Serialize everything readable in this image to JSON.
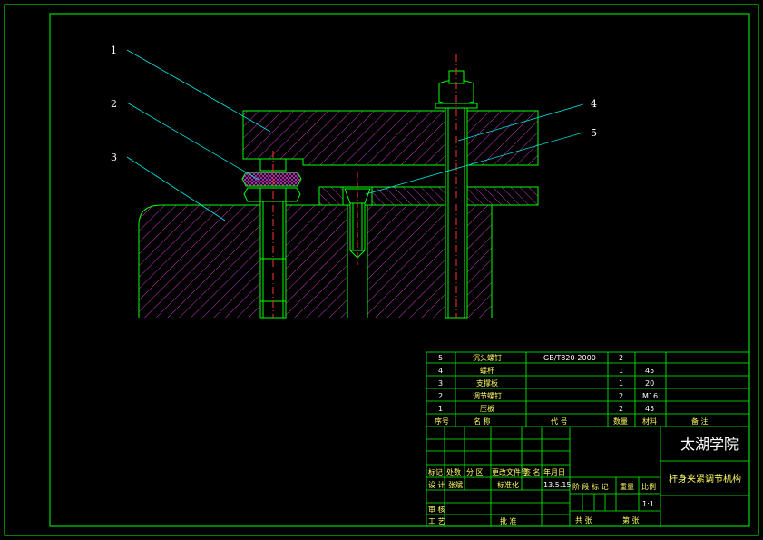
{
  "callouts": [
    "1",
    "2",
    "3",
    "4",
    "5"
  ],
  "parts": [
    {
      "no": "5",
      "name": "沉头螺钉",
      "code": "GB/T820-2000",
      "qty": "2",
      "material": "",
      "note": ""
    },
    {
      "no": "4",
      "name": "螺杆",
      "code": "",
      "qty": "1",
      "material": "45",
      "note": ""
    },
    {
      "no": "3",
      "name": "支撑板",
      "code": "",
      "qty": "1",
      "material": "20",
      "note": ""
    },
    {
      "no": "2",
      "name": "调节螺钉",
      "code": "",
      "qty": "2",
      "material": "M16",
      "note": ""
    },
    {
      "no": "1",
      "name": "压板",
      "code": "",
      "qty": "2",
      "material": "45",
      "note": ""
    }
  ],
  "header": {
    "no": "序号",
    "name": "名 称",
    "code": "代 号",
    "qty": "数量",
    "material": "材料",
    "note": "备 注"
  },
  "title_block": {
    "school": "太湖学院",
    "drawing_title": "杆身夹紧调节机构",
    "row_mark": "标记",
    "row_count": "处数",
    "row_zone": "分 区",
    "row_docno": "更改文件号",
    "row_sign": "签 名",
    "row_date": "年月日",
    "design": "设 计",
    "designer": "张斌",
    "standardize": "标准化",
    "date": "13.5.15",
    "stage": "阶 段 标 记",
    "weight": "重量",
    "scale": "比例",
    "scale_value": "1:1",
    "review": "审 核",
    "process": "工 艺",
    "approve": "批 准",
    "total": "共 张",
    "sheet": "第 张"
  },
  "colors": {
    "frame": "#00ff00",
    "hatch": "#cc33cc",
    "leader": "#00e5e5",
    "center": "#ff3333",
    "text": "#ffff66"
  }
}
